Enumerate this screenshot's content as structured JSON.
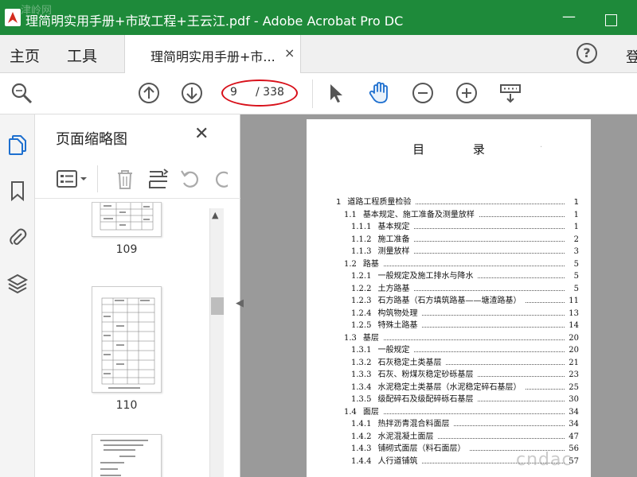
{
  "window": {
    "title": "理简明实用手册+市政工程+王云江.pdf - Adobe Acrobat Pro DC",
    "watermark_tl": "津岭网"
  },
  "tabs": {
    "home": "主页",
    "tools": "工具",
    "document": "理简明实用手册+市...",
    "close": "×",
    "signin": "登"
  },
  "toolbar": {
    "page_current": "9",
    "page_total": "/ 338",
    "highlight_color": "#d8101a"
  },
  "panel": {
    "title": "页面缩略图",
    "close": "✕",
    "thumbnails": [
      {
        "label": "109"
      },
      {
        "label": "110"
      }
    ]
  },
  "document": {
    "toc_heading": "目 录",
    "entries": [
      {
        "num": "1",
        "title": "道路工程质量检验",
        "page": "1",
        "indent": 0
      },
      {
        "num": "1.1",
        "title": "基本规定、施工准备及测量放样",
        "page": "1",
        "indent": 1
      },
      {
        "num": "1.1.1",
        "title": "基本规定",
        "page": "1",
        "indent": 2
      },
      {
        "num": "1.1.2",
        "title": "施工准备",
        "page": "2",
        "indent": 2
      },
      {
        "num": "1.1.3",
        "title": "测量放样",
        "page": "3",
        "indent": 2
      },
      {
        "num": "1.2",
        "title": "路基",
        "page": "5",
        "indent": 1
      },
      {
        "num": "1.2.1",
        "title": "一般规定及施工排水与降水",
        "page": "5",
        "indent": 2
      },
      {
        "num": "1.2.2",
        "title": "土方路基",
        "page": "5",
        "indent": 2
      },
      {
        "num": "1.2.3",
        "title": "石方路基（石方填筑路基——塘渣路基）",
        "page": "11",
        "indent": 2
      },
      {
        "num": "1.2.4",
        "title": "构筑物处理",
        "page": "13",
        "indent": 2
      },
      {
        "num": "1.2.5",
        "title": "特殊土路基",
        "page": "14",
        "indent": 2
      },
      {
        "num": "1.3",
        "title": "基层",
        "page": "20",
        "indent": 1
      },
      {
        "num": "1.3.1",
        "title": "一般规定",
        "page": "20",
        "indent": 2
      },
      {
        "num": "1.3.2",
        "title": "石灰稳定土类基层",
        "page": "21",
        "indent": 2
      },
      {
        "num": "1.3.3",
        "title": "石灰、粉煤灰稳定砂砾基层",
        "page": "23",
        "indent": 2
      },
      {
        "num": "1.3.4",
        "title": "水泥稳定土类基层（水泥稳定碎石基层）",
        "page": "25",
        "indent": 2
      },
      {
        "num": "1.3.5",
        "title": "级配碎石及级配碎砾石基层",
        "page": "30",
        "indent": 2
      },
      {
        "num": "1.4",
        "title": "面层",
        "page": "34",
        "indent": 1
      },
      {
        "num": "1.4.1",
        "title": "热拌沥青混合料面层",
        "page": "34",
        "indent": 2
      },
      {
        "num": "1.4.2",
        "title": "水泥混凝土面层",
        "page": "47",
        "indent": 2
      },
      {
        "num": "1.4.3",
        "title": "铺砌式面层（料石面层）",
        "page": "56",
        "indent": 2
      },
      {
        "num": "1.4.4",
        "title": "人行道铺筑",
        "page": "57",
        "indent": 2
      }
    ],
    "watermark": "cndac"
  }
}
